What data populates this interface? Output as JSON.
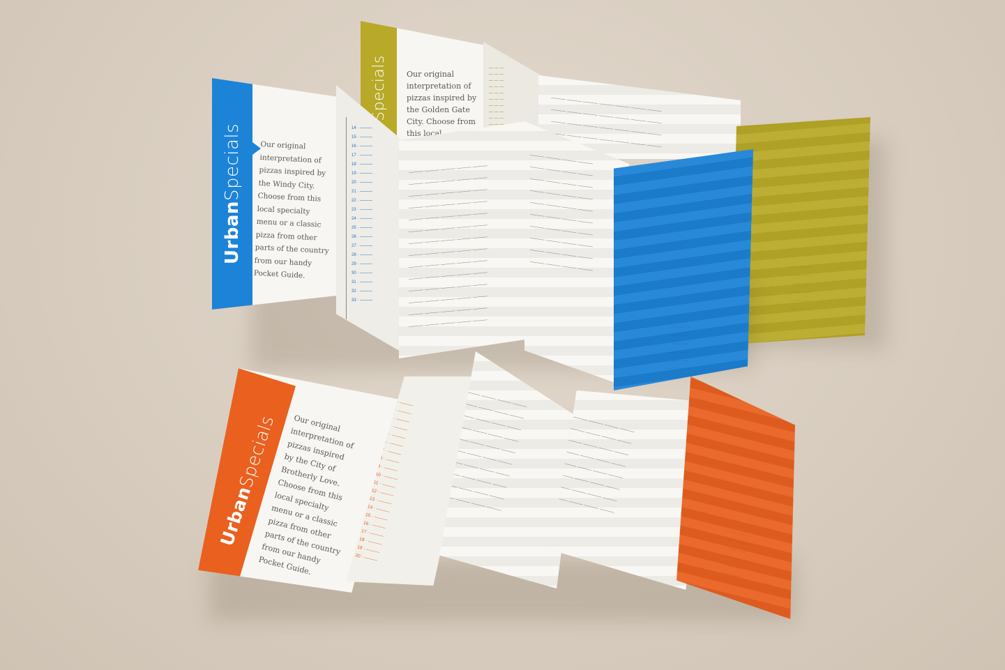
{
  "colors": {
    "backdrop": "#d9cfc2",
    "blue": "#1d83d6",
    "olive": "#b8a928",
    "orange": "#e9601f",
    "paper": "#f7f6f2"
  },
  "brochures": {
    "blue": {
      "brand_bold": "Urban",
      "brand_light": "Specials",
      "intro_lines": [
        "Our original",
        "interpretation of",
        "pizzas inspired by",
        "the Windy City.",
        "Choose from this",
        "local specialty",
        "menu or a classic",
        "pizza from other",
        "parts of the country",
        "from our handy",
        "Pocket Guide."
      ]
    },
    "olive": {
      "brand_light": "Specials",
      "intro_lines": [
        "Our original",
        "interpretation of",
        "pizzas inspired by",
        "the Golden Gate",
        "City. Choose from",
        "this local"
      ]
    },
    "orange": {
      "brand_bold": "Urban",
      "brand_light": "Specials",
      "intro_lines": [
        "Our original",
        "interpretation of",
        "pizzas inspired",
        "by the City of",
        "Brotherly Love.",
        "Choose from this",
        "local specialty",
        "menu or a classic",
        "pizza from other",
        "parts of the country",
        "from our handy",
        "Pocket Guide."
      ]
    }
  }
}
